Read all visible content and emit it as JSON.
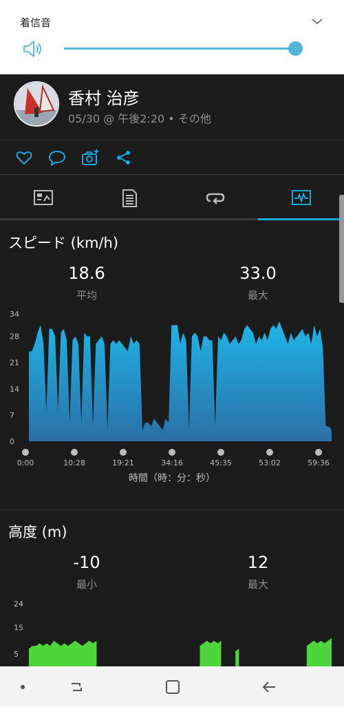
{
  "volume": {
    "label": "着信音",
    "level": 1.0,
    "icons": {
      "collapse": "chevron-down-icon",
      "speaker": "speaker-icon"
    },
    "accent_color": "#4fb6d6"
  },
  "activity": {
    "user_name": "香村 治彦",
    "meta": "05/30 @ 午後2:20 • その他"
  },
  "actions": {
    "icons": [
      "heart-icon",
      "comment-icon",
      "add-photo-icon",
      "share-icon"
    ]
  },
  "tabs": {
    "icons": [
      "summary-icon",
      "details-icon",
      "laps-icon",
      "charts-icon"
    ],
    "active_index": 3,
    "active_color": "#1aa6df"
  },
  "speed": {
    "title": "スピード (km/h)",
    "avg_value": "18.6",
    "avg_label": "平均",
    "max_value": "33.0",
    "max_label": "最大",
    "x_axis_label": "時間（時：分：秒）"
  },
  "altitude": {
    "title": "高度 (m)",
    "min_value": "-10",
    "min_label": "最小",
    "max_value": "12",
    "max_label": "最大"
  },
  "nav": {
    "icons": [
      "dot-icon",
      "recent-apps-icon",
      "home-icon",
      "back-icon"
    ]
  },
  "chart_data": [
    {
      "type": "area",
      "series": [
        {
          "values": [
            24,
            24,
            26,
            29,
            31,
            26,
            8,
            30,
            30,
            28,
            8,
            29,
            30,
            27,
            5,
            27,
            28,
            26,
            5,
            29,
            28,
            28,
            4,
            26,
            27,
            28,
            26,
            3,
            26,
            27,
            26,
            27,
            26,
            25,
            24,
            28,
            26,
            27,
            26,
            3,
            5,
            5,
            4,
            6,
            5,
            4,
            3,
            6,
            5,
            31,
            31,
            31,
            26,
            29,
            27,
            3,
            28,
            29,
            28,
            24,
            28,
            28,
            27,
            27,
            4,
            28,
            27,
            29,
            28,
            26,
            27,
            28,
            26,
            27,
            30,
            31,
            30,
            29,
            26,
            28,
            27,
            29,
            27,
            30,
            31,
            30,
            32,
            30,
            28,
            26,
            29,
            27,
            28,
            29,
            30,
            28,
            29,
            26,
            31,
            28,
            30,
            25,
            4,
            4,
            3
          ]
        }
      ],
      "x_tick_labels": [
        "0:00",
        "10:28",
        "19:21",
        "34:16",
        "45:35",
        "53:02",
        "59:36"
      ],
      "y_ticks": [
        0,
        7,
        14,
        21,
        28,
        34
      ],
      "ylim": [
        0,
        34
      ],
      "xlabel": "時間（時：分：秒）",
      "color": "#1aa6df"
    },
    {
      "type": "area",
      "series": [
        {
          "values": [
            7,
            8,
            8,
            9,
            8,
            9,
            8,
            10,
            9,
            8,
            9,
            8,
            9,
            10,
            9,
            8,
            9,
            10,
            9,
            10,
            null,
            null,
            null,
            null,
            null,
            null,
            null,
            null,
            null,
            null,
            null,
            null,
            null,
            null,
            null,
            null,
            null,
            null,
            null,
            null,
            null,
            null,
            null,
            null,
            null,
            null,
            null,
            null,
            8,
            9,
            10,
            9,
            10,
            9,
            10,
            null,
            null,
            null,
            6,
            7,
            null,
            null,
            null,
            null,
            null,
            null,
            null,
            null,
            null,
            null,
            null,
            null,
            null,
            null,
            null,
            null,
            null,
            null,
            8,
            9,
            10,
            9,
            10,
            9,
            10,
            11
          ]
        }
      ],
      "y_ticks": [
        5,
        15,
        24
      ],
      "color": "#4fd53c"
    }
  ]
}
